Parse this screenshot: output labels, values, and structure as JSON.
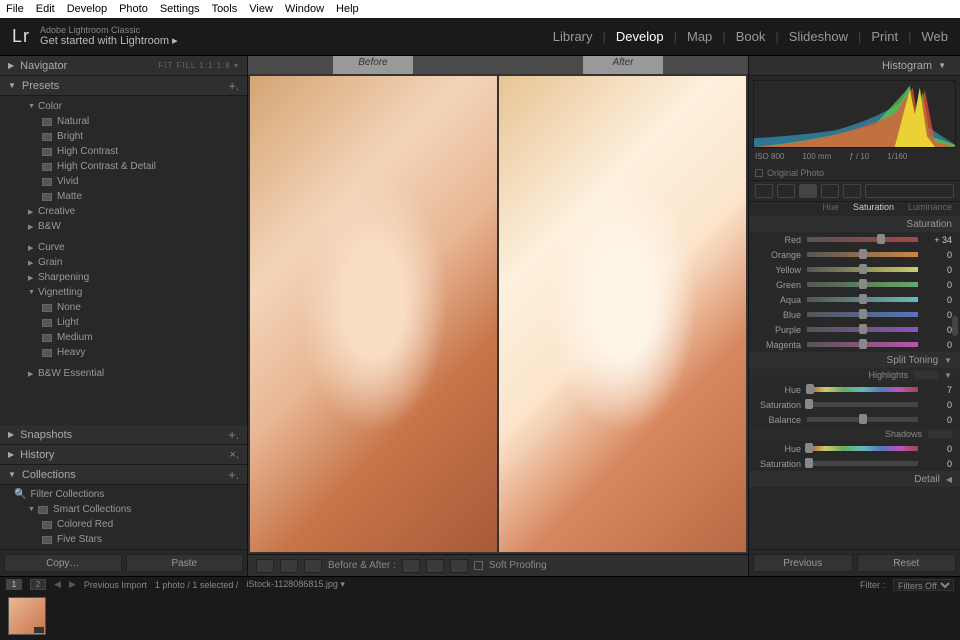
{
  "menubar": [
    "File",
    "Edit",
    "Develop",
    "Photo",
    "Settings",
    "Tools",
    "View",
    "Window",
    "Help"
  ],
  "app": {
    "name": "Lr",
    "line1": "Adobe Lightroom Classic",
    "line2": "Get started with Lightroom ▸"
  },
  "modules": [
    "Library",
    "Develop",
    "Map",
    "Book",
    "Slideshow",
    "Print",
    "Web"
  ],
  "active_module": "Develop",
  "nav": {
    "title": "Navigator",
    "opts": "FIT  FILL  1:1  1:8 ▾"
  },
  "presets": {
    "title": "Presets",
    "groups": [
      {
        "label": "Color",
        "open": true,
        "items": [
          "Natural",
          "Bright",
          "High Contrast",
          "High Contrast & Detail",
          "Vivid",
          "Matte"
        ]
      },
      {
        "label": "Creative",
        "open": false
      },
      {
        "label": "B&W",
        "open": false
      },
      {
        "label": "Curve",
        "open": false,
        "gap": true
      },
      {
        "label": "Grain",
        "open": false
      },
      {
        "label": "Sharpening",
        "open": false
      },
      {
        "label": "Vignetting",
        "open": true,
        "items": [
          "None",
          "Light",
          "Medium",
          "Heavy"
        ]
      },
      {
        "label": "B&W Essential",
        "open": false,
        "gap": true
      }
    ]
  },
  "snapshots": "Snapshots",
  "history": "History",
  "collections": {
    "title": "Collections",
    "filter": "Filter Collections",
    "smart": "Smart Collections",
    "items": [
      "Colored Red",
      "Five Stars"
    ]
  },
  "btns_left": {
    "copy": "Copy…",
    "paste": "Paste"
  },
  "before": "Before",
  "after": "After",
  "toolbar": {
    "balabel": "Before & After :",
    "soft": "Soft Proofing"
  },
  "hist": {
    "title": "Histogram",
    "iso": "ISO 800",
    "mm": "100 mm",
    "f": "ƒ / 10",
    "sh": "1/160",
    "orig": "Original Photo"
  },
  "hsl_tabs": [
    "Hue",
    "Saturation",
    "Luminance"
  ],
  "hsl_active": "Saturation",
  "sat": [
    {
      "label": "Red",
      "val": "+ 34",
      "pos": 67,
      "cls": "red"
    },
    {
      "label": "Orange",
      "val": "0",
      "pos": 50,
      "cls": "orange"
    },
    {
      "label": "Yellow",
      "val": "0",
      "pos": 50,
      "cls": "yellow"
    },
    {
      "label": "Green",
      "val": "0",
      "pos": 50,
      "cls": "green"
    },
    {
      "label": "Aqua",
      "val": "0",
      "pos": 50,
      "cls": "aqua"
    },
    {
      "label": "Blue",
      "val": "0",
      "pos": 50,
      "cls": "blue"
    },
    {
      "label": "Purple",
      "val": "0",
      "pos": 50,
      "cls": "purple"
    },
    {
      "label": "Magenta",
      "val": "0",
      "pos": 50,
      "cls": "magenta"
    }
  ],
  "split": {
    "title": "Split Toning",
    "highlights": "Highlights",
    "shadows": "Shadows",
    "rows": [
      {
        "label": "Hue",
        "val": "7",
        "pos": 3,
        "cls": "hue"
      },
      {
        "label": "Saturation",
        "val": "0",
        "pos": 2,
        "cls": "gray"
      }
    ],
    "balance": {
      "label": "Balance",
      "val": "0",
      "pos": 50,
      "cls": "gray"
    },
    "shadow_rows": [
      {
        "label": "Hue",
        "val": "0",
        "pos": 2,
        "cls": "hue"
      },
      {
        "label": "Saturation",
        "val": "0",
        "pos": 2,
        "cls": "gray"
      }
    ]
  },
  "detail": "Detail",
  "btns_right": {
    "prev": "Previous",
    "reset": "Reset"
  },
  "filmstrip": {
    "prev": "Previous Import",
    "count": "1 photo / 1 selected /",
    "file": "iStock-1128086815.jpg ▾",
    "filter": "Filter :",
    "filters_off": "Filters Off"
  }
}
